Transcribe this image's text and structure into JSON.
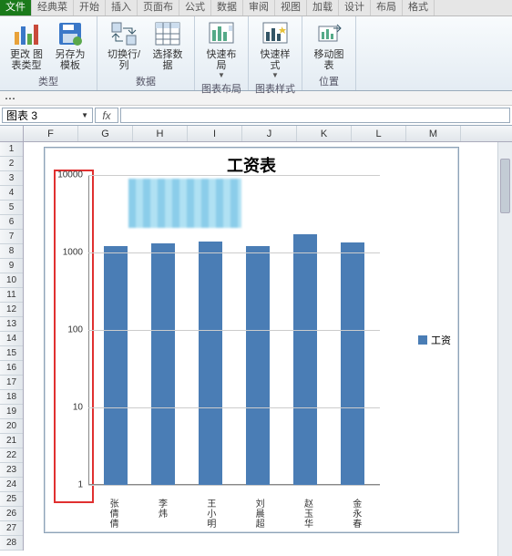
{
  "tabs": {
    "file": "文件",
    "t1": "经典菜",
    "t2": "开始",
    "t3": "插入",
    "t4": "页面布",
    "t5": "公式",
    "t6": "数据",
    "t7": "审阅",
    "t8": "视图",
    "t9": "加载",
    "t10": "设计",
    "t11": "布局",
    "t12": "格式"
  },
  "ribbon": {
    "g1": {
      "label": "类型",
      "btn1": "更改\n图表类型",
      "btn2": "另存为\n模板"
    },
    "g2": {
      "label": "数据",
      "btn1": "切换行/列",
      "btn2": "选择数据"
    },
    "g3": {
      "label": "图表布局",
      "btn1": "快速布局"
    },
    "g4": {
      "label": "图表样式",
      "btn1": "快速样式"
    },
    "g5": {
      "label": "位置",
      "btn1": "移动图表"
    }
  },
  "namebox": "图表 3",
  "fx": "fx",
  "columns": [
    "F",
    "G",
    "H",
    "I",
    "J",
    "K",
    "L",
    "M"
  ],
  "rows_count": 28,
  "chart_data": {
    "type": "bar",
    "title": "工资表",
    "series_name": "工资",
    "categories": [
      "张倩倩",
      "李炜",
      "王小明",
      "刘晨超",
      "赵玉华",
      "金永春"
    ],
    "values": [
      1200,
      1300,
      1400,
      1200,
      1700,
      1350
    ],
    "yticks": [
      1,
      10,
      100,
      1000,
      10000
    ],
    "yscale": "log",
    "ylim": [
      1,
      10000
    ]
  },
  "legend_label": "工资"
}
